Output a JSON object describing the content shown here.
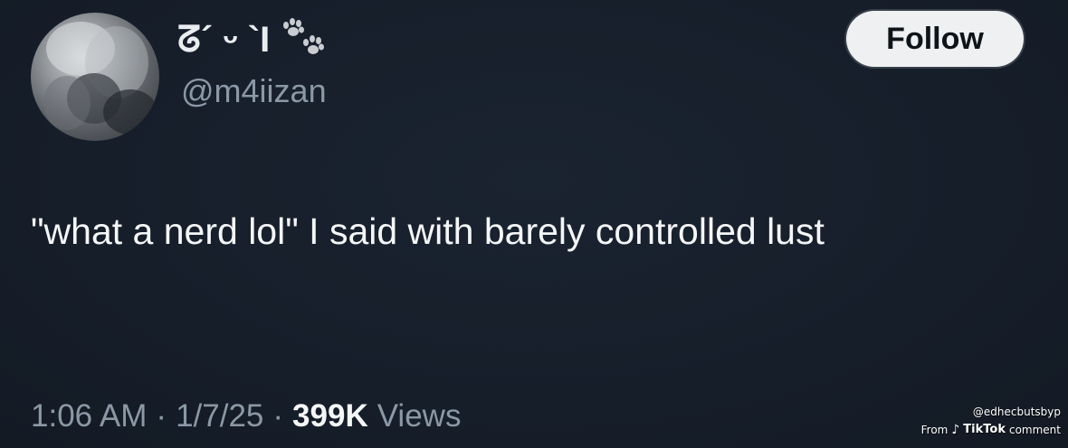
{
  "author": {
    "display_name": "ᘔ´ ᵕ `Ɩ",
    "handle": "@m4iizan",
    "name_icon": "paw-prints-icon"
  },
  "follow_label": "Follow",
  "tweet_text": "\"what a nerd lol\" I said with barely controlled lust",
  "meta": {
    "time": "1:06 AM",
    "separator": "·",
    "date": "1/7/25",
    "views_count": "399K",
    "views_label": "Views"
  },
  "watermark": {
    "user": "@edhecbutsbyp",
    "from": "From",
    "icon": "tiktok-icon",
    "brand": "TikTok",
    "suffix": "comment"
  },
  "colors": {
    "background": "#161e2a",
    "text": "#f4f6f8",
    "secondary_text": "#8b98a5",
    "follow_button_bg": "#eef0f2"
  }
}
